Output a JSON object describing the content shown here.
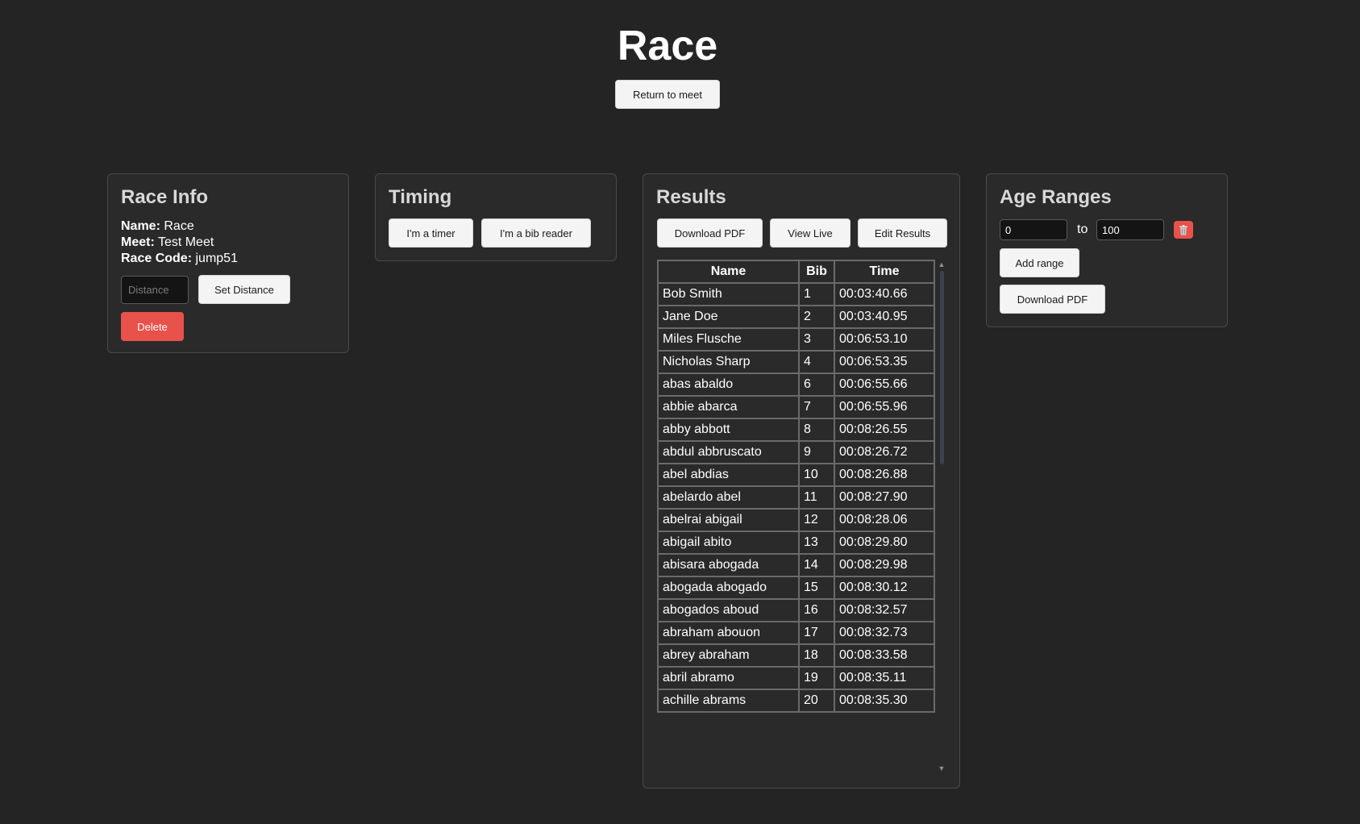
{
  "header": {
    "title": "Race",
    "return_label": "Return to meet"
  },
  "race_info": {
    "title": "Race Info",
    "name_key": "Name:",
    "name_value": "Race",
    "meet_key": "Meet:",
    "meet_value": "Test Meet",
    "code_key": "Race Code:",
    "code_value": "jump51",
    "distance_placeholder": "Distance",
    "distance_value": "",
    "set_distance_label": "Set Distance",
    "delete_label": "Delete"
  },
  "timing": {
    "title": "Timing",
    "timer_label": "I'm a timer",
    "bib_reader_label": "I'm a bib reader"
  },
  "results": {
    "title": "Results",
    "download_label": "Download PDF",
    "view_live_label": "View Live",
    "edit_label": "Edit Results",
    "columns": [
      "Name",
      "Bib",
      "Time"
    ],
    "rows": [
      [
        "Bob Smith",
        "1",
        "00:03:40.66"
      ],
      [
        "Jane Doe",
        "2",
        "00:03:40.95"
      ],
      [
        "Miles Flusche",
        "3",
        "00:06:53.10"
      ],
      [
        "Nicholas Sharp",
        "4",
        "00:06:53.35"
      ],
      [
        "abas abaldo",
        "6",
        "00:06:55.66"
      ],
      [
        "abbie abarca",
        "7",
        "00:06:55.96"
      ],
      [
        "abby abbott",
        "8",
        "00:08:26.55"
      ],
      [
        "abdul abbruscato",
        "9",
        "00:08:26.72"
      ],
      [
        "abel abdias",
        "10",
        "00:08:26.88"
      ],
      [
        "abelardo abel",
        "11",
        "00:08:27.90"
      ],
      [
        "abelrai abigail",
        "12",
        "00:08:28.06"
      ],
      [
        "abigail abito",
        "13",
        "00:08:29.80"
      ],
      [
        "abisara abogada",
        "14",
        "00:08:29.98"
      ],
      [
        "abogada abogado",
        "15",
        "00:08:30.12"
      ],
      [
        "abogados aboud",
        "16",
        "00:08:32.57"
      ],
      [
        "abraham abouon",
        "17",
        "00:08:32.73"
      ],
      [
        "abrey abraham",
        "18",
        "00:08:33.58"
      ],
      [
        "abril abramo",
        "19",
        "00:08:35.11"
      ],
      [
        "achille abrams",
        "20",
        "00:08:35.30"
      ]
    ]
  },
  "age_ranges": {
    "title": "Age Ranges",
    "from_value": "0",
    "to_label": "to",
    "to_value": "100",
    "add_label": "Add range",
    "download_label": "Download PDF",
    "trash_icon": "trash-icon"
  },
  "colors": {
    "background": "#242424",
    "card": "#2a2a2a",
    "danger": "#e8524a",
    "button": "#f4f4f4"
  }
}
